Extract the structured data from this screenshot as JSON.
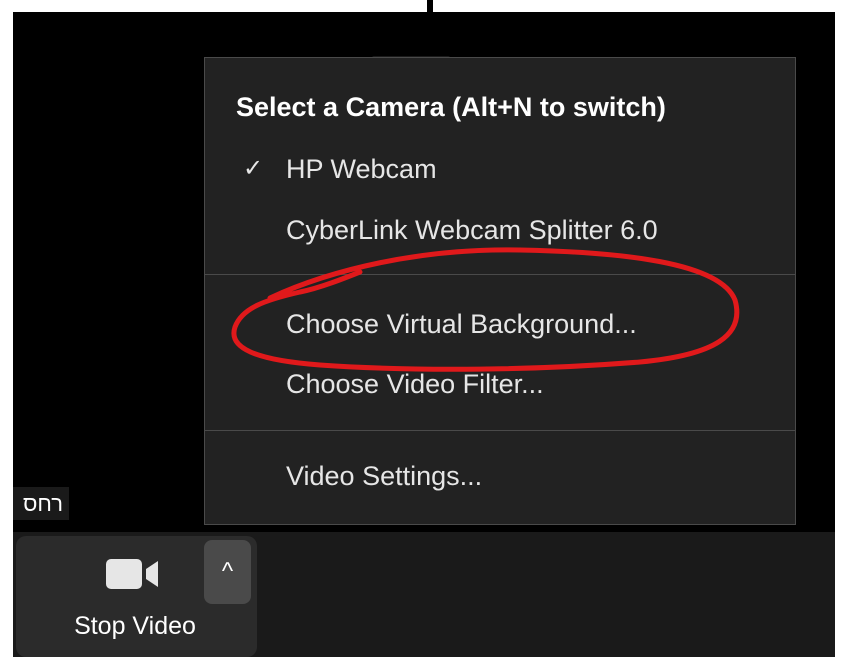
{
  "camera_menu": {
    "heading": "Select a Camera (Alt+N to switch)",
    "cameras": [
      {
        "label": "HP Webcam",
        "selected": true
      },
      {
        "label": "CyberLink Webcam Splitter 6.0",
        "selected": false
      }
    ],
    "virtual_background": "Choose Virtual Background...",
    "video_filter": "Choose Video Filter...",
    "video_settings": "Video Settings..."
  },
  "participant_name_tag": "רחס",
  "toolbar": {
    "stop_video_label": "Stop Video",
    "chevron_glyph": "^"
  },
  "icons": {
    "check": "checkmark-icon",
    "camera": "video-camera-icon",
    "chevron": "chevron-up-icon"
  },
  "colors": {
    "menu_bg": "#222222",
    "annotation": "#e0191b"
  }
}
